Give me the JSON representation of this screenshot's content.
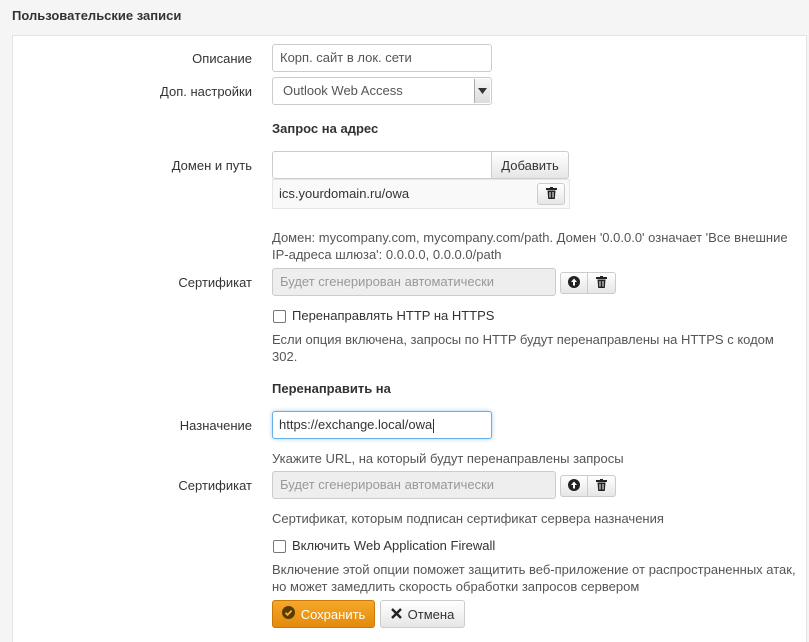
{
  "header": {
    "title": "Пользовательские записи"
  },
  "form": {
    "description": {
      "label": "Описание",
      "value": "Корп. сайт в лок. сети"
    },
    "extra_settings": {
      "label": "Доп. настройки",
      "selected": "Outlook Web Access"
    },
    "request_section": {
      "title": "Запрос на адрес"
    },
    "domain": {
      "label": "Домен и путь",
      "value": "",
      "add_label": "Добавить",
      "entries": [
        "ics.yourdomain.ru/owa"
      ],
      "help": "Домен: mycompany.com, mycompany.com/path. Домен '0.0.0.0' означает 'Все внешние IP-адреса шлюза': 0.0.0.0, 0.0.0.0/path"
    },
    "certificate1": {
      "label": "Сертификат",
      "placeholder": "Будет сгенерирован автоматически"
    },
    "redirect_https": {
      "label": "Перенаправлять HTTP на HTTPS",
      "checked": false,
      "help": "Если опция включена, запросы по HTTP будут перенаправлены на HTTPS с кодом 302."
    },
    "redirect_section": {
      "title": "Перенаправить на"
    },
    "destination": {
      "label": "Назначение",
      "value": "https://exchange.local/owa",
      "help": "Укажите URL, на который будут перенаправлены запросы"
    },
    "certificate2": {
      "label": "Сертификат",
      "placeholder": "Будет сгенерирован автоматически",
      "help": "Сертификат, которым подписан сертификат сервера назначения"
    },
    "waf": {
      "label": "Включить Web Application Firewall",
      "checked": false,
      "help": "Включение этой опции поможет защитить веб-приложение от распространенных атак, но может замедлить скорость обработки запросов сервером"
    },
    "actions": {
      "save_label": "Сохранить",
      "cancel_label": "Отмена"
    }
  },
  "colors": {
    "primary": "#f0a020",
    "focus": "#66afe9"
  }
}
